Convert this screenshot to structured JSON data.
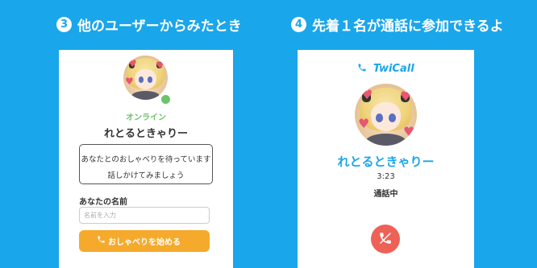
{
  "steps": {
    "left": {
      "number": "3",
      "title": "他のユーザーからみたとき"
    },
    "right": {
      "number": "4",
      "title": "先着１名が通話に参加できるよ"
    }
  },
  "profile_view": {
    "status_text": "オンライン",
    "user_name": "れとるときゃりー",
    "message_line1": "あなたとのおしゃべりを待っています",
    "message_line2": "話しかけてみましょう",
    "name_label": "あなたの名前",
    "name_placeholder": "名前を入力",
    "name_value": "",
    "start_button_label": "おしゃべりを始める"
  },
  "call_view": {
    "brand": "TwiCall",
    "user_name": "れとるときゃりー",
    "timer": "3:23",
    "status": "通話中"
  },
  "colors": {
    "background": "#1aa6ea",
    "accent": "#1aa6ea",
    "online": "#6cc36a",
    "start_button": "#f5aa2c",
    "end_call": "#ee6157"
  },
  "icons": {
    "start_button": "phone-icon",
    "end_call": "phone-hangup-icon",
    "brand": "phone-icon"
  }
}
